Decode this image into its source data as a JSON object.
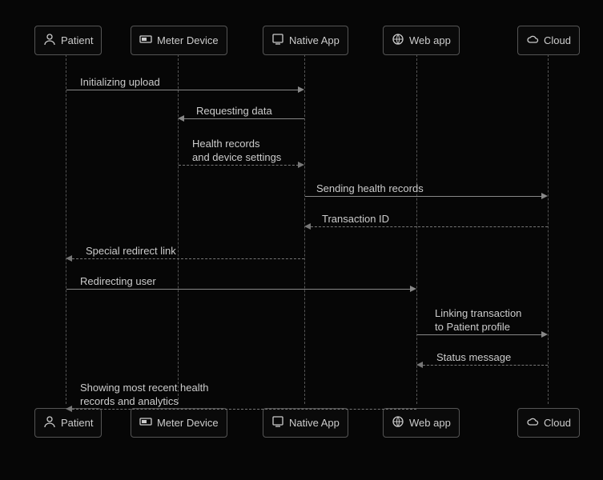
{
  "actors": {
    "patient": "Patient",
    "meter": "Meter Device",
    "native": "Native App",
    "web": "Web app",
    "cloud": "Cloud"
  },
  "messages": {
    "m1": "Initializing upload",
    "m2": "Requesting data",
    "m3": "Health records\nand device settings",
    "m4": "Sending health records",
    "m5": "Transaction ID",
    "m6": "Special redirect link",
    "m7": "Redirecting user",
    "m8": "Linking transaction\nto Patient profile",
    "m9": "Status message",
    "m10": "Showing most recent health\nrecords and analytics"
  },
  "chart_data": {
    "type": "sequence_diagram",
    "actors": [
      "Patient",
      "Meter Device",
      "Native App",
      "Web app",
      "Cloud"
    ],
    "messages": [
      {
        "from": "Patient",
        "to": "Native App",
        "label": "Initializing upload",
        "style": "solid"
      },
      {
        "from": "Native App",
        "to": "Meter Device",
        "label": "Requesting data",
        "style": "solid"
      },
      {
        "from": "Meter Device",
        "to": "Native App",
        "label": "Health records and device settings",
        "style": "dashed"
      },
      {
        "from": "Native App",
        "to": "Cloud",
        "label": "Sending health records",
        "style": "solid"
      },
      {
        "from": "Cloud",
        "to": "Native App",
        "label": "Transaction ID",
        "style": "dashed"
      },
      {
        "from": "Native App",
        "to": "Patient",
        "label": "Special redirect link",
        "style": "dashed"
      },
      {
        "from": "Patient",
        "to": "Web app",
        "label": "Redirecting user",
        "style": "solid"
      },
      {
        "from": "Web app",
        "to": "Cloud",
        "label": "Linking transaction to Patient profile",
        "style": "solid"
      },
      {
        "from": "Cloud",
        "to": "Web app",
        "label": "Status message",
        "style": "dashed"
      },
      {
        "from": "Web app",
        "to": "Patient",
        "label": "Showing most recent health records and analytics",
        "style": "dashed"
      }
    ]
  }
}
